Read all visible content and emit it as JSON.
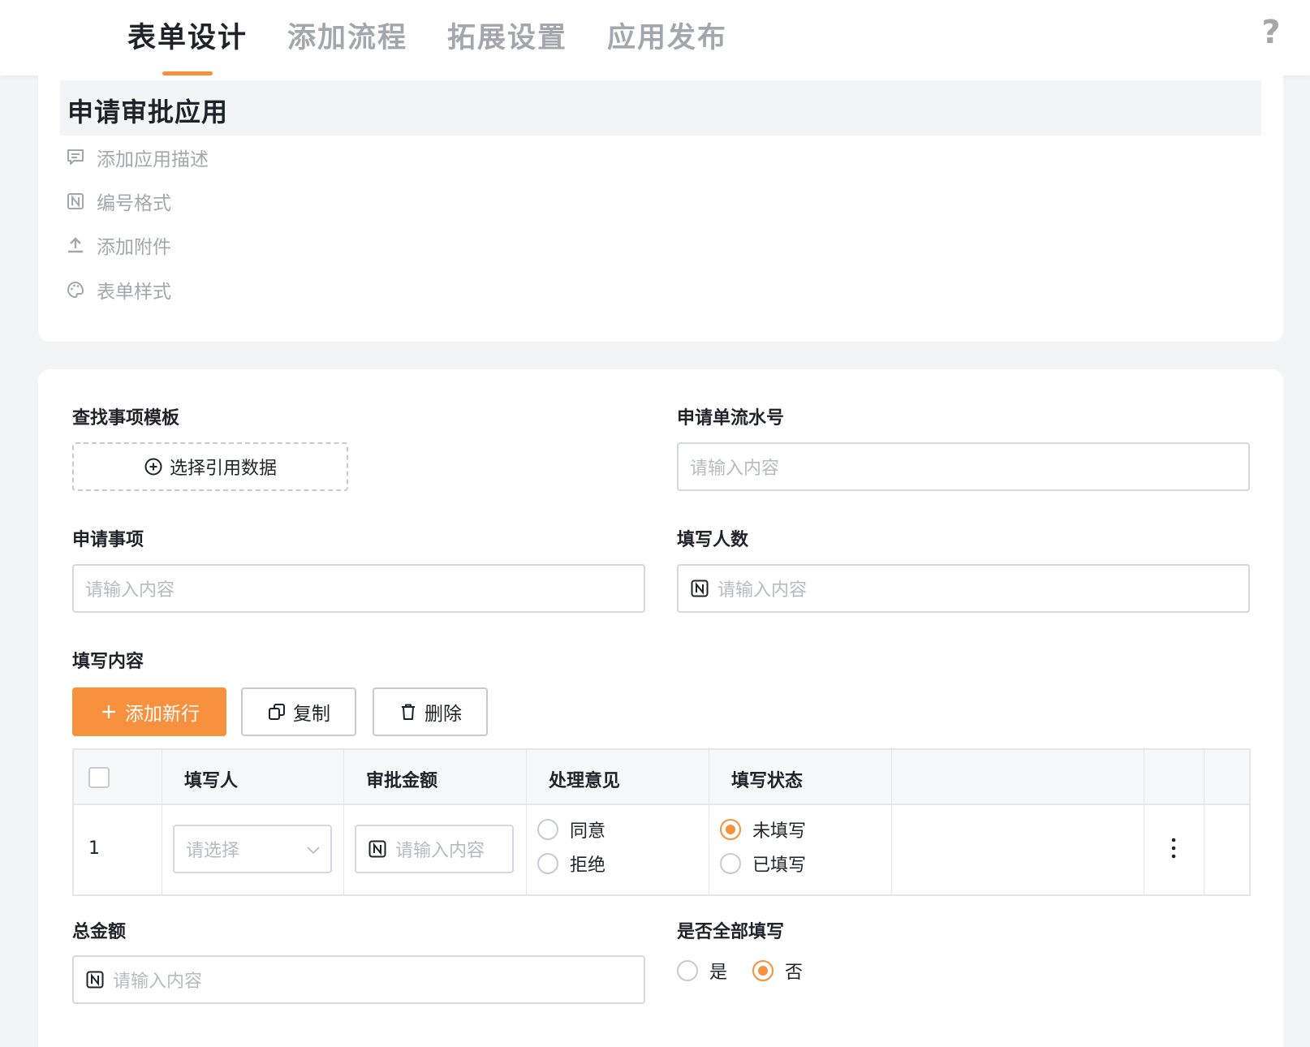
{
  "tabs": [
    {
      "label": "表单设计",
      "active": true
    },
    {
      "label": "添加流程",
      "active": false
    },
    {
      "label": "拓展设置",
      "active": false
    },
    {
      "label": "应用发布",
      "active": false
    }
  ],
  "help_icon": "?",
  "app": {
    "title": "申请审批应用",
    "meta": [
      {
        "icon": "comment-icon",
        "label": "添加应用描述"
      },
      {
        "icon": "number-format-icon",
        "label": "编号格式"
      },
      {
        "icon": "upload-icon",
        "label": "添加附件"
      },
      {
        "icon": "palette-icon",
        "label": "表单样式"
      }
    ]
  },
  "form": {
    "template_label": "查找事项模板",
    "template_button": "选择引用数据",
    "serial_label": "申请单流水号",
    "serial_placeholder": "请输入内容",
    "item_label": "申请事项",
    "item_placeholder": "请输入内容",
    "count_label": "填写人数",
    "count_placeholder": "请输入内容",
    "content_label": "填写内容",
    "add_row": "添加新行",
    "copy": "复制",
    "delete": "删除",
    "table": {
      "headers": [
        "填写人",
        "审批金额",
        "处理意见",
        "填写状态"
      ],
      "rows": [
        {
          "index": "1",
          "filler_placeholder": "请选择",
          "amount_placeholder": "请输入内容",
          "opinion_options": [
            "同意",
            "拒绝"
          ],
          "opinion_selected": null,
          "status_options": [
            "未填写",
            "已填写"
          ],
          "status_selected": "未填写"
        }
      ]
    },
    "total_label": "总金额",
    "total_placeholder": "请输入内容",
    "all_filled_label": "是否全部填写",
    "all_filled_options": [
      "是",
      "否"
    ],
    "all_filled_selected": "否"
  },
  "colors": {
    "accent": "#f7913d",
    "text": "#1f2329",
    "muted": "#a3a7ad",
    "placeholder": "#b7bbc0"
  }
}
